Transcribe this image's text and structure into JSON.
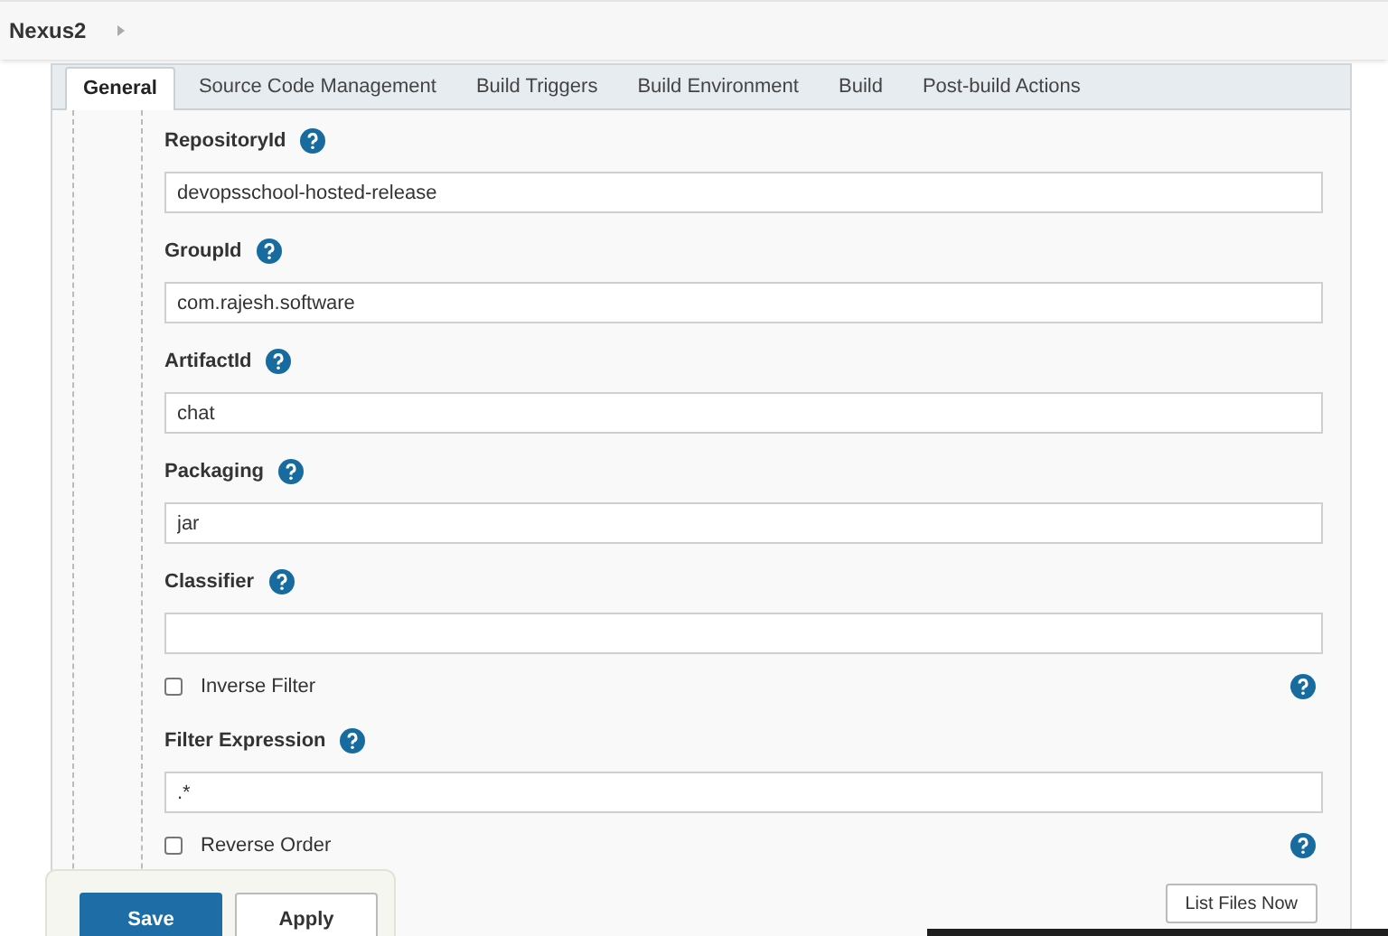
{
  "header": {
    "title": "Nexus2"
  },
  "tabs": [
    {
      "label": "General",
      "selected": true
    },
    {
      "label": "Source Code Management",
      "selected": false
    },
    {
      "label": "Build Triggers",
      "selected": false
    },
    {
      "label": "Build Environment",
      "selected": false
    },
    {
      "label": "Build",
      "selected": false
    },
    {
      "label": "Post-build Actions",
      "selected": false
    }
  ],
  "fields": [
    {
      "kind": "text",
      "label": "RepositoryId",
      "value": "devopsschool-hosted-release"
    },
    {
      "kind": "text",
      "label": "GroupId",
      "value": "com.rajesh.software"
    },
    {
      "kind": "text",
      "label": "ArtifactId",
      "value": "chat"
    },
    {
      "kind": "text",
      "label": "Packaging",
      "value": "jar"
    },
    {
      "kind": "text",
      "label": "Classifier"
    },
    {
      "kind": "checkbox",
      "label": "Inverse Filter",
      "checked": false
    },
    {
      "kind": "text",
      "label": "Filter Expression",
      "value": ".*"
    },
    {
      "kind": "checkbox",
      "label": "Reverse Order",
      "checked": false
    }
  ],
  "list_button": "List Files Now",
  "actions": [
    "Save",
    "Apply"
  ]
}
